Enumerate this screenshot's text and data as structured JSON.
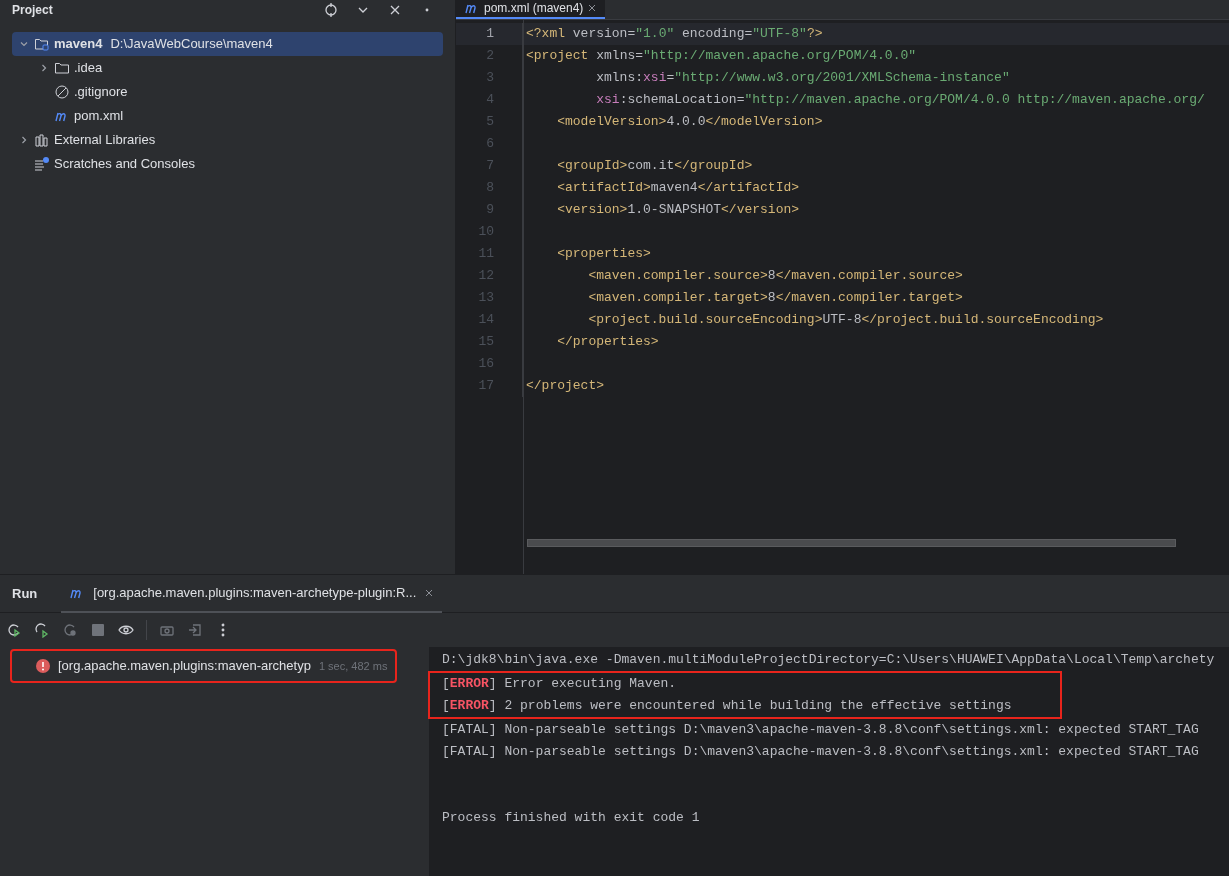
{
  "project_panel": {
    "title": "Project",
    "tree": [
      {
        "label": "maven4",
        "path": "D:\\JavaWebCourse\\maven4",
        "kind": "module",
        "expanded": true,
        "selected": true,
        "children": [
          {
            "label": ".idea",
            "kind": "folder",
            "expanded": false,
            "selected": false
          },
          {
            "label": ".gitignore",
            "kind": "ignored",
            "selected": false
          },
          {
            "label": "pom.xml",
            "kind": "maven",
            "selected": false
          }
        ]
      },
      {
        "label": "External Libraries",
        "kind": "libraries",
        "expanded": false,
        "selected": false
      },
      {
        "label": "Scratches and Consoles",
        "kind": "scratches",
        "selected": false
      }
    ]
  },
  "editor": {
    "tabs": [
      {
        "label": "pom.xml (maven4)",
        "selected": true
      }
    ],
    "lines": [
      {
        "number": "1",
        "current": true,
        "tokens": [
          {
            "kind": "tag",
            "text": "<?xml"
          },
          {
            "kind": "attr",
            "text": " version="
          },
          {
            "kind": "value",
            "text": "\"1.0\""
          },
          {
            "kind": "attr",
            "text": " encoding="
          },
          {
            "kind": "value",
            "text": "\"UTF-8\""
          },
          {
            "kind": "tag",
            "text": "?>"
          }
        ]
      },
      {
        "number": "2",
        "current": false,
        "tokens": [
          {
            "kind": "tag",
            "text": "<project"
          },
          {
            "kind": "attr",
            "text": " xmlns="
          },
          {
            "kind": "value",
            "text": "\"http://maven.apache.org/POM/4.0.0\""
          }
        ]
      },
      {
        "number": "3",
        "current": false,
        "tokens": [
          {
            "kind": "attr",
            "text": "         xmlns:"
          },
          {
            "kind": "ns",
            "text": "xsi"
          },
          {
            "kind": "attr",
            "text": "="
          },
          {
            "kind": "value",
            "text": "\"http://www.w3.org/2001/XMLSchema-instance\""
          }
        ]
      },
      {
        "number": "4",
        "current": false,
        "tokens": [
          {
            "kind": "ns",
            "text": "         xsi"
          },
          {
            "kind": "attr",
            "text": ":schemaLocation="
          },
          {
            "kind": "value",
            "text": "\"http://maven.apache.org/POM/4.0.0 http://maven.apache.org/"
          }
        ]
      },
      {
        "number": "5",
        "current": false,
        "tokens": [
          {
            "kind": "tag",
            "text": "    <modelVersion>"
          },
          {
            "kind": "text",
            "text": "4.0.0"
          },
          {
            "kind": "tag",
            "text": "</modelVersion>"
          }
        ]
      },
      {
        "number": "6",
        "current": false
      },
      {
        "number": "7",
        "current": false,
        "tokens": [
          {
            "kind": "tag",
            "text": "    <groupId>"
          },
          {
            "kind": "text",
            "text": "com.it"
          },
          {
            "kind": "tag",
            "text": "</groupId>"
          }
        ]
      },
      {
        "number": "8",
        "current": false,
        "tokens": [
          {
            "kind": "tag",
            "text": "    <artifactId>"
          },
          {
            "kind": "text",
            "text": "maven4"
          },
          {
            "kind": "tag",
            "text": "</artifactId>"
          }
        ]
      },
      {
        "number": "9",
        "current": false,
        "tokens": [
          {
            "kind": "tag",
            "text": "    <version>"
          },
          {
            "kind": "text",
            "text": "1.0-SNAPSHOT"
          },
          {
            "kind": "tag",
            "text": "</version>"
          }
        ]
      },
      {
        "number": "10",
        "current": false
      },
      {
        "number": "11",
        "current": false,
        "tokens": [
          {
            "kind": "tag",
            "text": "    <properties>"
          }
        ]
      },
      {
        "number": "12",
        "current": false,
        "tokens": [
          {
            "kind": "tag",
            "text": "        <maven.compiler.source>"
          },
          {
            "kind": "text",
            "text": "8"
          },
          {
            "kind": "tag",
            "text": "</maven.compiler.source>"
          }
        ]
      },
      {
        "number": "13",
        "current": false,
        "tokens": [
          {
            "kind": "tag",
            "text": "        <maven.compiler.target>"
          },
          {
            "kind": "text",
            "text": "8"
          },
          {
            "kind": "tag",
            "text": "</maven.compiler.target>"
          }
        ]
      },
      {
        "number": "14",
        "current": false,
        "tokens": [
          {
            "kind": "tag",
            "text": "        <project.build.sourceEncoding>"
          },
          {
            "kind": "text",
            "text": "UTF-8"
          },
          {
            "kind": "tag",
            "text": "</project.build.sourceEncoding>"
          }
        ]
      },
      {
        "number": "15",
        "current": false,
        "tokens": [
          {
            "kind": "tag",
            "text": "    </properties>"
          }
        ]
      },
      {
        "number": "16",
        "current": false
      },
      {
        "number": "17",
        "current": false,
        "tokens": [
          {
            "kind": "tag",
            "text": "</project>"
          }
        ]
      }
    ]
  },
  "run_panel": {
    "title": "Run",
    "tabs": [
      {
        "label": "[org.apache.maven.plugins:maven-archetype-plugin:R...",
        "selected": true
      }
    ],
    "tree": [
      {
        "label": "[org.apache.maven.plugins:maven-archetyp",
        "kind": "error",
        "time": "1 sec, 482 ms",
        "highlighted": true
      }
    ],
    "console": [
      {
        "highlighted": false,
        "tokens": [
          {
            "kind": "text",
            "text": "D:\\jdk8\\bin\\java.exe -Dmaven.multiModuleProjectDirectory=C:\\Users\\HUAWEI\\AppData\\Local\\Temp\\archety"
          }
        ]
      },
      {
        "highlighted": true,
        "tokens": [
          {
            "kind": "text",
            "text": "["
          },
          {
            "kind": "error",
            "text": "ERROR"
          },
          {
            "kind": "text",
            "text": "] Error executing Maven."
          }
        ]
      },
      {
        "highlighted": true,
        "tokens": [
          {
            "kind": "text",
            "text": "["
          },
          {
            "kind": "error",
            "text": "ERROR"
          },
          {
            "kind": "text",
            "text": "] 2 problems were encountered while building the effective settings"
          }
        ]
      },
      {
        "highlighted": false,
        "tokens": [
          {
            "kind": "text",
            "text": "[FATAL] Non-parseable settings D:\\maven3\\apache-maven-3.8.8\\conf\\settings.xml: expected START_TAG"
          }
        ]
      },
      {
        "highlighted": false,
        "tokens": [
          {
            "kind": "text",
            "text": "[FATAL] Non-parseable settings D:\\maven3\\apache-maven-3.8.8\\conf\\settings.xml: expected START_TAG"
          }
        ]
      },
      {
        "highlighted": false
      },
      {
        "highlighted": false
      },
      {
        "highlighted": false,
        "tokens": [
          {
            "kind": "text",
            "text": "Process finished with exit code 1"
          }
        ]
      }
    ]
  }
}
